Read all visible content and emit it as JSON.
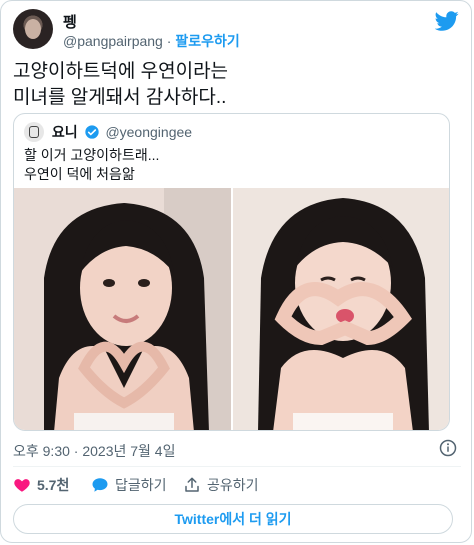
{
  "author": {
    "name": "펭",
    "handle": "@pangpairpang",
    "separator": "·",
    "follow_label": "팔로우하기"
  },
  "tweet": {
    "text": "고양이하트덕에 우연이라는\n미녀를 알게돼서 감사하다.."
  },
  "quote": {
    "name": "요니",
    "handle": "@yeongingee",
    "text": "할 이거 고양이하트래...\n우연이 덕에 처음앎"
  },
  "meta": {
    "timestamp": "오후 9:30 · 2023년 7월 4일"
  },
  "actions": {
    "like_count": "5.7천",
    "reply_label": "답글하기",
    "share_label": "공유하기"
  },
  "read_more": "Twitter에서 더 읽기",
  "colors": {
    "accent": "#1d9bf0",
    "like": "#f91880",
    "text": "#0f1419",
    "muted": "#536471"
  },
  "icons": [
    "twitter-bird-icon",
    "verified-badge-icon",
    "info-icon",
    "heart-icon",
    "reply-bubble-icon",
    "share-icon"
  ]
}
